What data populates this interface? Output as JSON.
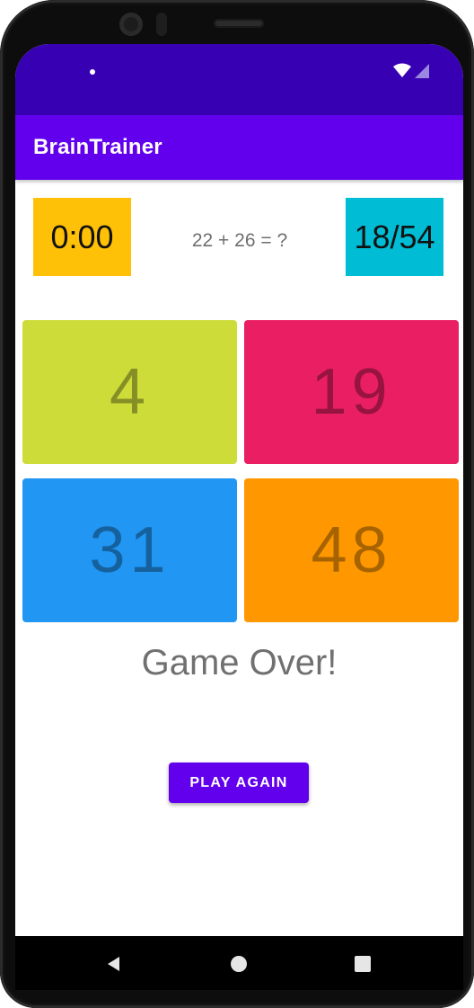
{
  "app": {
    "title": "BrainTrainer"
  },
  "game": {
    "timer": "0:00",
    "question": "22 + 26 = ?",
    "score": "18/54",
    "answers": [
      "4",
      "19",
      "31",
      "48"
    ],
    "result": "Game Over!",
    "play_again_label": "PLAY AGAIN"
  },
  "colors": {
    "status_bar": "#3700b3",
    "app_bar": "#6200ee",
    "timer_bg": "#ffc107",
    "score_bg": "#00bcd4",
    "tiles": [
      "#cddc39",
      "#e91e63",
      "#2196f3",
      "#ff9800"
    ]
  },
  "icons": {
    "status": [
      "notification-dot-icon",
      "wifi-icon",
      "cellular-signal-icon"
    ],
    "navigation": [
      "back-icon",
      "home-icon",
      "recents-icon"
    ]
  }
}
